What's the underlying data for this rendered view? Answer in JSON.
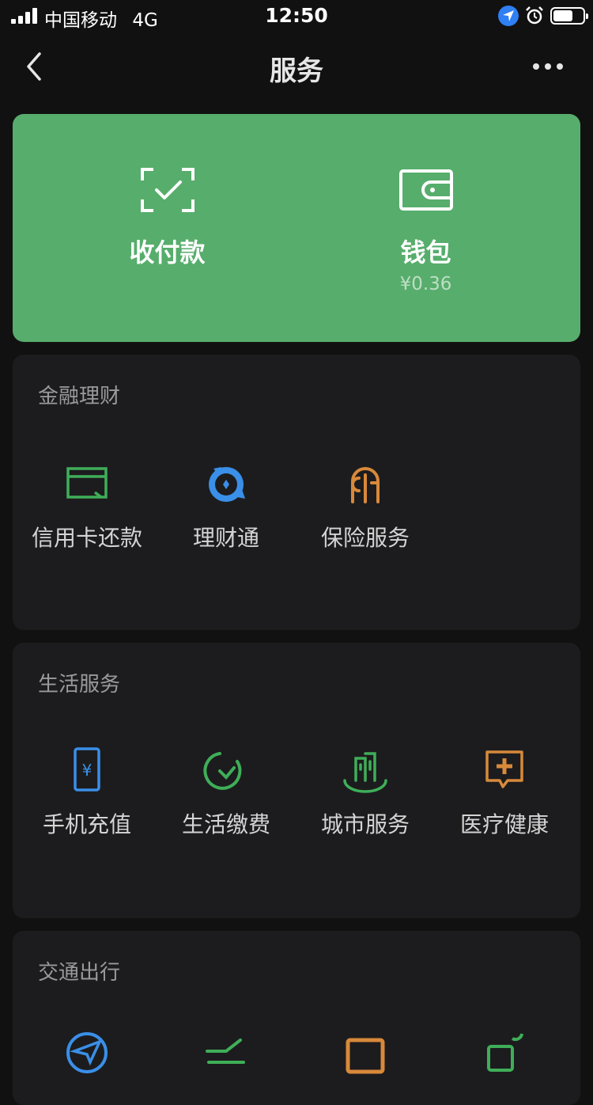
{
  "status_bar": {
    "carrier": "中国移动",
    "network": "4G",
    "time": "12:50"
  },
  "nav": {
    "title": "服务",
    "back_icon": "chevron-left-icon",
    "more_icon": "more-icon"
  },
  "wallet_card": {
    "background": "#57ad6c",
    "pay": {
      "label": "收付款",
      "icon": "scan-check-icon"
    },
    "wallet": {
      "label": "钱包",
      "balance": "¥0.36",
      "icon": "wallet-icon"
    }
  },
  "sections": [
    {
      "title": "金融理财",
      "items": [
        {
          "label": "信用卡还款",
          "icon": "credit-card-icon",
          "color": "#3fae58"
        },
        {
          "label": "理财通",
          "icon": "wealth-icon",
          "color": "#3a8fe8"
        },
        {
          "label": "保险服务",
          "icon": "insurance-icon",
          "color": "#d8893a"
        }
      ]
    },
    {
      "title": "生活服务",
      "items": [
        {
          "label": "手机充值",
          "icon": "phone-recharge-icon",
          "color": "#3a8fe8"
        },
        {
          "label": "生活缴费",
          "icon": "utility-icon",
          "color": "#3fae58"
        },
        {
          "label": "城市服务",
          "icon": "city-icon",
          "color": "#3fae58"
        },
        {
          "label": "医疗健康",
          "icon": "medical-icon",
          "color": "#d8893a"
        }
      ]
    },
    {
      "title": "交通出行",
      "items": [
        {
          "icon": "plane-icon",
          "color": "#3a8fe8"
        },
        {
          "icon": "train-icon",
          "color": "#3fae58"
        },
        {
          "icon": "bus-icon",
          "color": "#d8893a"
        },
        {
          "icon": "hotel-icon",
          "color": "#3fae58"
        }
      ]
    }
  ]
}
